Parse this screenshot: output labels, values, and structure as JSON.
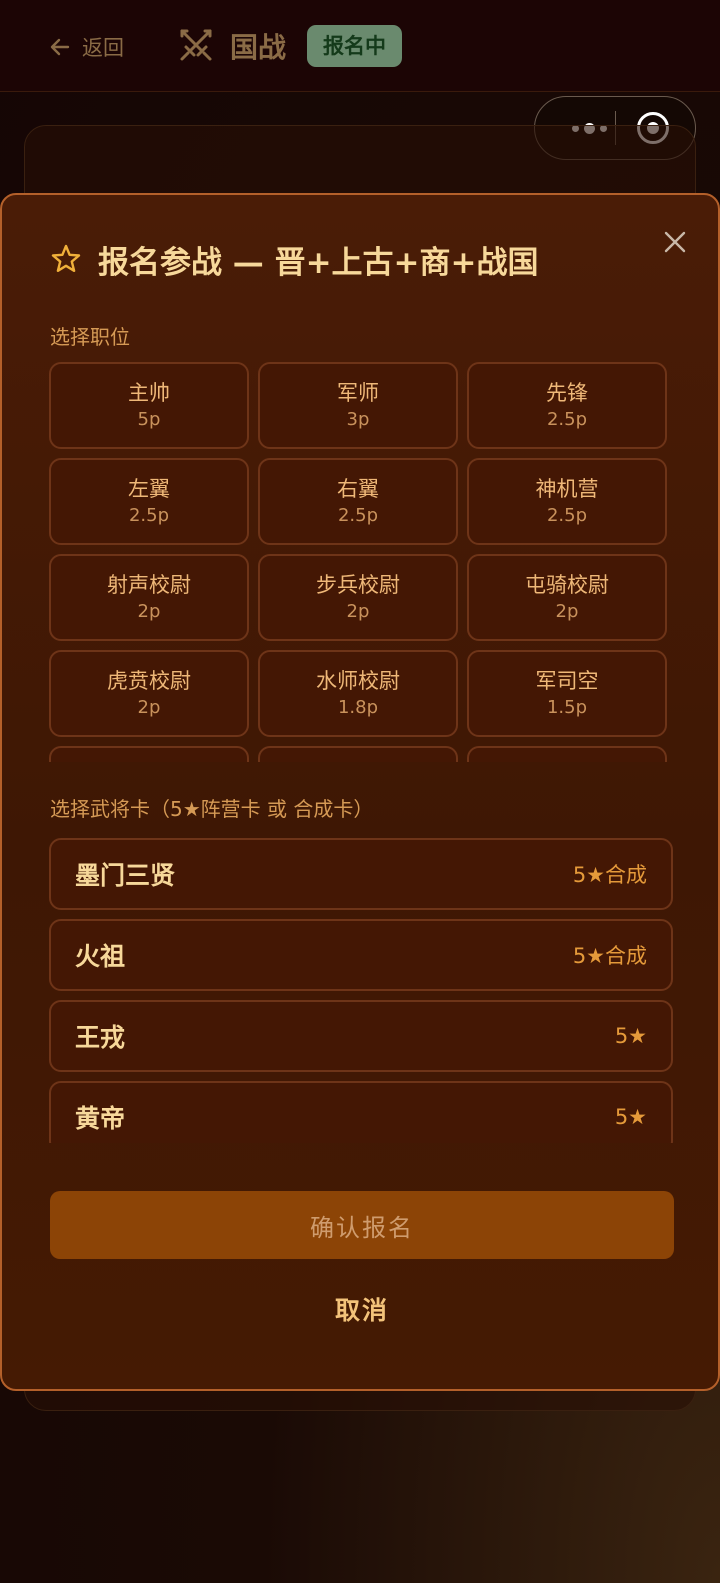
{
  "header": {
    "back_label": "返回",
    "title": "国战",
    "status": "报名中"
  },
  "modal": {
    "title": "报名参战 — 晋+上古+商+战国",
    "positions_label": "选择职位",
    "positions": [
      {
        "name": "主帅",
        "points": "5p"
      },
      {
        "name": "军师",
        "points": "3p"
      },
      {
        "name": "先锋",
        "points": "2.5p"
      },
      {
        "name": "左翼",
        "points": "2.5p"
      },
      {
        "name": "右翼",
        "points": "2.5p"
      },
      {
        "name": "神机营",
        "points": "2.5p"
      },
      {
        "name": "射声校尉",
        "points": "2p"
      },
      {
        "name": "步兵校尉",
        "points": "2p"
      },
      {
        "name": "屯骑校尉",
        "points": "2p"
      },
      {
        "name": "虎贲校尉",
        "points": "2p"
      },
      {
        "name": "水师校尉",
        "points": "1.8p"
      },
      {
        "name": "军司空",
        "points": "1.5p"
      },
      {
        "name": "",
        "points": ""
      },
      {
        "name": "",
        "points": ""
      },
      {
        "name": "",
        "points": ""
      }
    ],
    "generals_label": "选择武将卡（5★阵营卡 或 合成卡）",
    "generals": [
      {
        "name": "墨门三贤",
        "tag": "5★合成"
      },
      {
        "name": "火祖",
        "tag": "5★合成"
      },
      {
        "name": "王戎",
        "tag": "5★"
      },
      {
        "name": "黄帝",
        "tag": "5★"
      }
    ],
    "confirm_label": "确认报名",
    "cancel_label": "取消"
  },
  "icons": {
    "back": "arrow-left-icon",
    "swords": "crossed-swords-icon",
    "star": "star-outline-icon",
    "close": "close-icon",
    "more": "more-dots-icon",
    "target": "target-icon"
  },
  "colors": {
    "accent": "#f3c37a",
    "badge_bg": "#6a8a6e",
    "modal_border": "#b4602a",
    "confirm_bg": "#8c4406"
  }
}
